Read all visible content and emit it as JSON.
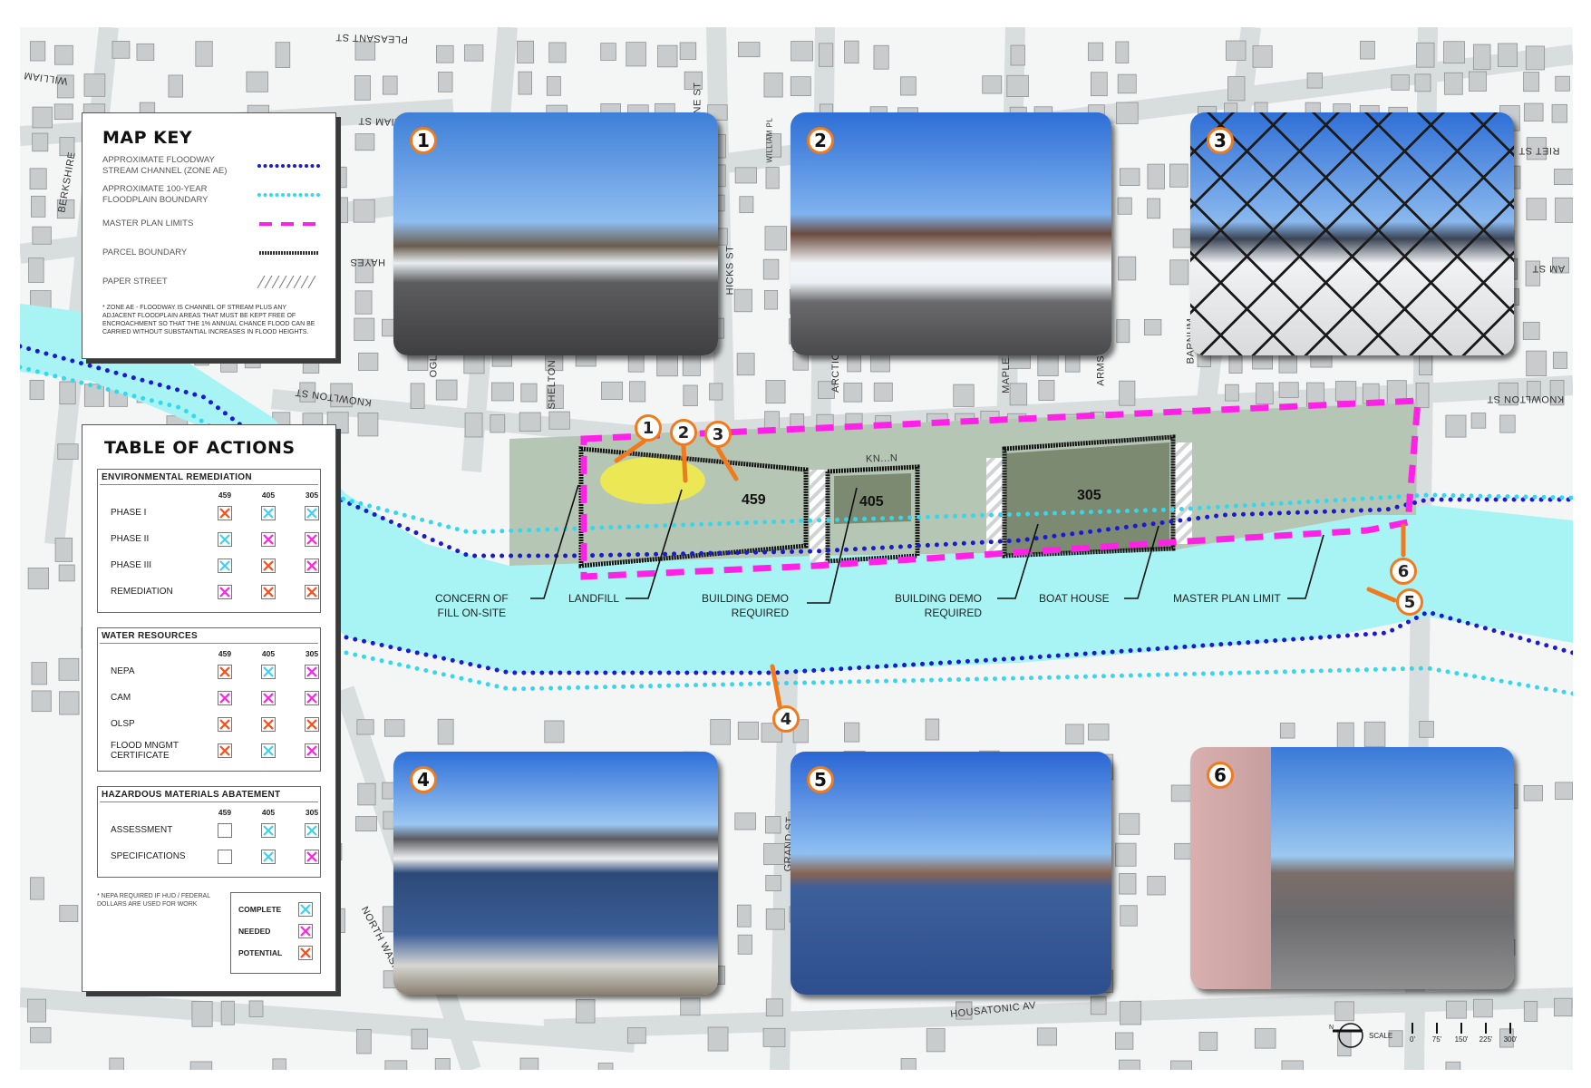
{
  "colors": {
    "river": "#a8f4f4",
    "floodway_line": "#1a1ad0",
    "floodplain_line": "#33d8ee",
    "master_plan": "#ff22e6",
    "marker_orange": "#f07a1c",
    "complete": "#40d0f0",
    "needed": "#ff22e6",
    "potential": "#ff4a1a",
    "landfill": "#f2ea4a"
  },
  "map_key": {
    "title": "MAP KEY",
    "items": [
      {
        "label": "APPROXIMATE FLOODWAY STREAM CHANNEL (ZONE AE)",
        "symbol": "blue-dotted-line"
      },
      {
        "label": "APPROXIMATE 100-YEAR FLOODPLAIN BOUNDARY",
        "symbol": "cyan-dotted-line"
      },
      {
        "label": "MASTER PLAN LIMITS",
        "symbol": "magenta-dashed-line"
      },
      {
        "label": "PARCEL BOUNDARY",
        "symbol": "hatched-line"
      },
      {
        "label": "PAPER STREET",
        "symbol": "diagonal-hatch"
      }
    ],
    "footnote": "* ZONE AE - FLOODWAY IS CHANNEL OF STREAM PLUS ANY ADJACENT FLOODPLAIN AREAS THAT MUST BE KEPT FREE OF ENCROACHMENT SO THAT THE 1% ANNUAL CHANCE FLOOD CAN BE CARRIED WITHOUT SUBSTANTIAL INCREASES IN FLOOD HEIGHTS."
  },
  "table_of_actions": {
    "title": "TABLE OF ACTIONS",
    "columns": [
      "459",
      "405",
      "305"
    ],
    "sections": [
      {
        "title": "ENVIRONMENTAL REMEDIATION",
        "rows": [
          {
            "label": "PHASE I",
            "status": [
              "potential",
              "complete",
              "complete"
            ]
          },
          {
            "label": "PHASE II",
            "status": [
              "complete",
              "needed",
              "needed"
            ]
          },
          {
            "label": "PHASE III",
            "status": [
              "complete",
              "potential",
              "needed"
            ]
          },
          {
            "label": "REMEDIATION",
            "status": [
              "needed",
              "potential",
              "potential"
            ]
          }
        ]
      },
      {
        "title": "WATER RESOURCES",
        "rows": [
          {
            "label": "NEPA",
            "status": [
              "potential",
              "complete",
              "needed"
            ]
          },
          {
            "label": "CAM",
            "status": [
              "needed",
              "needed",
              "needed"
            ]
          },
          {
            "label": "OLSP",
            "status": [
              "potential",
              "potential",
              "potential"
            ]
          },
          {
            "label": "FLOOD MNGMT CERTIFICATE",
            "status": [
              "potential",
              "complete",
              "needed"
            ]
          }
        ]
      },
      {
        "title": "HAZARDOUS MATERIALS ABATEMENT",
        "rows": [
          {
            "label": "ASSESSMENT",
            "status": [
              "none",
              "complete",
              "complete"
            ]
          },
          {
            "label": "SPECIFICATIONS",
            "status": [
              "none",
              "complete",
              "needed"
            ]
          }
        ]
      }
    ],
    "footnote": "* NEPA REQUIRED IF HUD / FEDERAL DOLLARS ARE USED FOR WORK",
    "legend": [
      {
        "label": "COMPLETE",
        "status": "complete"
      },
      {
        "label": "NEEDED",
        "status": "needed"
      },
      {
        "label": "POTENTIAL",
        "status": "potential"
      }
    ]
  },
  "photos": [
    {
      "number": "1"
    },
    {
      "number": "2"
    },
    {
      "number": "3"
    },
    {
      "number": "4"
    },
    {
      "number": "5"
    },
    {
      "number": "6"
    }
  ],
  "map": {
    "parcels": [
      "459",
      "405",
      "305"
    ],
    "markers": [
      "1",
      "2",
      "3",
      "4",
      "5",
      "6"
    ],
    "callouts": {
      "concern_fill_1": "CONCERN OF",
      "concern_fill_2": "FILL ON-SITE",
      "landfill": "LANDFILL",
      "demo_a_1": "BUILDING DEMO",
      "demo_a_2": "REQUIRED",
      "demo_b_1": "BUILDING DEMO",
      "demo_b_2": "REQUIRED",
      "boat_house": "BOAT HOUSE",
      "master_plan_limit": "MASTER PLAN LIMIT"
    },
    "streets": {
      "pleasant": "PLEASANT ST",
      "william_w": "WILLIAM",
      "william_st": "WILLIAM ST",
      "berkshire": "BERKSHIRE",
      "hayes": "HAYES",
      "ogl": "OGL",
      "shelton": "SHELTON",
      "hicks": "HICKS ST",
      "line": "NE ST",
      "william_pl": "WILLIAM PL",
      "arctic": "ARCTIC",
      "maple": "MAPLE",
      "armstr": "ARMSTR",
      "barnum": "BARNUM",
      "knowlton_w": "KNOWLTON ST",
      "knowlton_mid": "KN...N",
      "knowlton_e": "KNOWLTON ST",
      "harriet": "RIET ST",
      "william_e": "AM ST",
      "grand": "GRAND ST",
      "north_wash": "NORTH WASH",
      "housatonic": "HOUSATONIC AV"
    },
    "scale": {
      "label": "SCALE",
      "ticks": [
        "0'",
        "75'",
        "150'",
        "225'",
        "300'"
      ],
      "north": "N"
    }
  }
}
